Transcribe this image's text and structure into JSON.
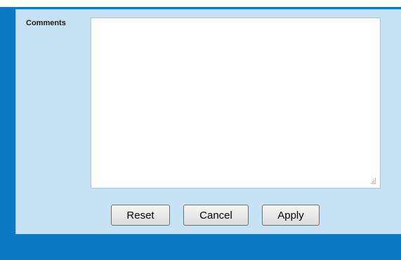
{
  "form": {
    "comments_label": "Comments",
    "comments_value": ""
  },
  "buttons": {
    "reset_label": "Reset",
    "cancel_label": "Cancel",
    "apply_label": "Apply"
  },
  "colors": {
    "frame": "#0a79c6",
    "panel": "#c6e2f4"
  },
  "icons": {
    "resize_grip": "resize-grip-icon"
  }
}
